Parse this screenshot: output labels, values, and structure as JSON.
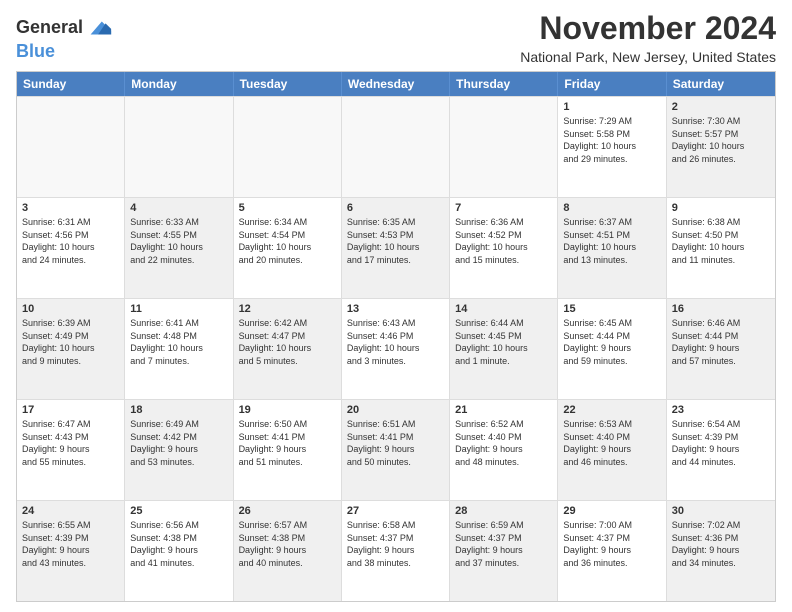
{
  "header": {
    "logo_line1": "General",
    "logo_line2": "Blue",
    "title": "November 2024",
    "subtitle": "National Park, New Jersey, United States"
  },
  "calendar": {
    "days": [
      "Sunday",
      "Monday",
      "Tuesday",
      "Wednesday",
      "Thursday",
      "Friday",
      "Saturday"
    ],
    "rows": [
      [
        {
          "num": "",
          "info": "",
          "empty": true
        },
        {
          "num": "",
          "info": "",
          "empty": true
        },
        {
          "num": "",
          "info": "",
          "empty": true
        },
        {
          "num": "",
          "info": "",
          "empty": true
        },
        {
          "num": "",
          "info": "",
          "empty": true
        },
        {
          "num": "1",
          "info": "Sunrise: 7:29 AM\nSunset: 5:58 PM\nDaylight: 10 hours\nand 29 minutes.",
          "empty": false
        },
        {
          "num": "2",
          "info": "Sunrise: 7:30 AM\nSunset: 5:57 PM\nDaylight: 10 hours\nand 26 minutes.",
          "empty": false,
          "shaded": true
        }
      ],
      [
        {
          "num": "3",
          "info": "Sunrise: 6:31 AM\nSunset: 4:56 PM\nDaylight: 10 hours\nand 24 minutes.",
          "empty": false
        },
        {
          "num": "4",
          "info": "Sunrise: 6:33 AM\nSunset: 4:55 PM\nDaylight: 10 hours\nand 22 minutes.",
          "empty": false,
          "shaded": true
        },
        {
          "num": "5",
          "info": "Sunrise: 6:34 AM\nSunset: 4:54 PM\nDaylight: 10 hours\nand 20 minutes.",
          "empty": false
        },
        {
          "num": "6",
          "info": "Sunrise: 6:35 AM\nSunset: 4:53 PM\nDaylight: 10 hours\nand 17 minutes.",
          "empty": false,
          "shaded": true
        },
        {
          "num": "7",
          "info": "Sunrise: 6:36 AM\nSunset: 4:52 PM\nDaylight: 10 hours\nand 15 minutes.",
          "empty": false
        },
        {
          "num": "8",
          "info": "Sunrise: 6:37 AM\nSunset: 4:51 PM\nDaylight: 10 hours\nand 13 minutes.",
          "empty": false,
          "shaded": true
        },
        {
          "num": "9",
          "info": "Sunrise: 6:38 AM\nSunset: 4:50 PM\nDaylight: 10 hours\nand 11 minutes.",
          "empty": false
        }
      ],
      [
        {
          "num": "10",
          "info": "Sunrise: 6:39 AM\nSunset: 4:49 PM\nDaylight: 10 hours\nand 9 minutes.",
          "empty": false,
          "shaded": true
        },
        {
          "num": "11",
          "info": "Sunrise: 6:41 AM\nSunset: 4:48 PM\nDaylight: 10 hours\nand 7 minutes.",
          "empty": false
        },
        {
          "num": "12",
          "info": "Sunrise: 6:42 AM\nSunset: 4:47 PM\nDaylight: 10 hours\nand 5 minutes.",
          "empty": false,
          "shaded": true
        },
        {
          "num": "13",
          "info": "Sunrise: 6:43 AM\nSunset: 4:46 PM\nDaylight: 10 hours\nand 3 minutes.",
          "empty": false
        },
        {
          "num": "14",
          "info": "Sunrise: 6:44 AM\nSunset: 4:45 PM\nDaylight: 10 hours\nand 1 minute.",
          "empty": false,
          "shaded": true
        },
        {
          "num": "15",
          "info": "Sunrise: 6:45 AM\nSunset: 4:44 PM\nDaylight: 9 hours\nand 59 minutes.",
          "empty": false
        },
        {
          "num": "16",
          "info": "Sunrise: 6:46 AM\nSunset: 4:44 PM\nDaylight: 9 hours\nand 57 minutes.",
          "empty": false,
          "shaded": true
        }
      ],
      [
        {
          "num": "17",
          "info": "Sunrise: 6:47 AM\nSunset: 4:43 PM\nDaylight: 9 hours\nand 55 minutes.",
          "empty": false
        },
        {
          "num": "18",
          "info": "Sunrise: 6:49 AM\nSunset: 4:42 PM\nDaylight: 9 hours\nand 53 minutes.",
          "empty": false,
          "shaded": true
        },
        {
          "num": "19",
          "info": "Sunrise: 6:50 AM\nSunset: 4:41 PM\nDaylight: 9 hours\nand 51 minutes.",
          "empty": false
        },
        {
          "num": "20",
          "info": "Sunrise: 6:51 AM\nSunset: 4:41 PM\nDaylight: 9 hours\nand 50 minutes.",
          "empty": false,
          "shaded": true
        },
        {
          "num": "21",
          "info": "Sunrise: 6:52 AM\nSunset: 4:40 PM\nDaylight: 9 hours\nand 48 minutes.",
          "empty": false
        },
        {
          "num": "22",
          "info": "Sunrise: 6:53 AM\nSunset: 4:40 PM\nDaylight: 9 hours\nand 46 minutes.",
          "empty": false,
          "shaded": true
        },
        {
          "num": "23",
          "info": "Sunrise: 6:54 AM\nSunset: 4:39 PM\nDaylight: 9 hours\nand 44 minutes.",
          "empty": false
        }
      ],
      [
        {
          "num": "24",
          "info": "Sunrise: 6:55 AM\nSunset: 4:39 PM\nDaylight: 9 hours\nand 43 minutes.",
          "empty": false,
          "shaded": true
        },
        {
          "num": "25",
          "info": "Sunrise: 6:56 AM\nSunset: 4:38 PM\nDaylight: 9 hours\nand 41 minutes.",
          "empty": false
        },
        {
          "num": "26",
          "info": "Sunrise: 6:57 AM\nSunset: 4:38 PM\nDaylight: 9 hours\nand 40 minutes.",
          "empty": false,
          "shaded": true
        },
        {
          "num": "27",
          "info": "Sunrise: 6:58 AM\nSunset: 4:37 PM\nDaylight: 9 hours\nand 38 minutes.",
          "empty": false
        },
        {
          "num": "28",
          "info": "Sunrise: 6:59 AM\nSunset: 4:37 PM\nDaylight: 9 hours\nand 37 minutes.",
          "empty": false,
          "shaded": true
        },
        {
          "num": "29",
          "info": "Sunrise: 7:00 AM\nSunset: 4:37 PM\nDaylight: 9 hours\nand 36 minutes.",
          "empty": false
        },
        {
          "num": "30",
          "info": "Sunrise: 7:02 AM\nSunset: 4:36 PM\nDaylight: 9 hours\nand 34 minutes.",
          "empty": false,
          "shaded": true
        }
      ]
    ]
  }
}
